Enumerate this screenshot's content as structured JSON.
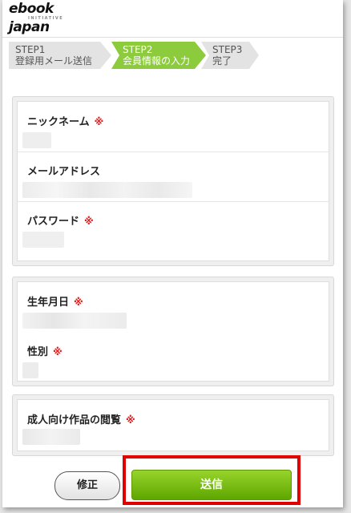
{
  "header": {
    "logo_line1": "ebook",
    "logo_tagline": "INITIATIVE",
    "logo_line2": "japan"
  },
  "steps": [
    {
      "num": "STEP1",
      "label": "登録用メール送信"
    },
    {
      "num": "STEP2",
      "label": "会員情報の入力",
      "active": true
    },
    {
      "num": "STEP3",
      "label": "完了"
    }
  ],
  "colors": {
    "accent_green": "#8ccb3b",
    "required_mark": "#e02020",
    "highlight_red": "#e00000"
  },
  "required_mark": "※",
  "form": {
    "nickname_label": "ニックネーム",
    "email_label": "メールアドレス",
    "password_label": "パスワード",
    "birthday_label": "生年月日",
    "gender_label": "性別",
    "adult_label": "成人向け作品の閲覧"
  },
  "buttons": {
    "edit": "修正",
    "send": "送信"
  }
}
